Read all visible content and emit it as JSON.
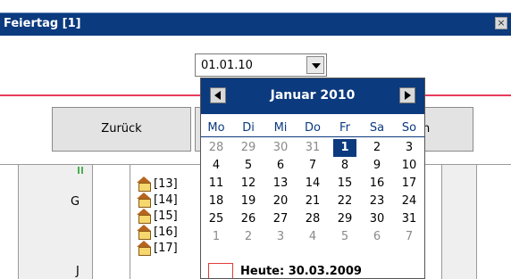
{
  "window": {
    "title": "Feiertag [1]",
    "close_glyph": "×"
  },
  "date_input": {
    "value": "01.01.10"
  },
  "buttons": {
    "back_label": "Zurück",
    "right_partial_label": "n"
  },
  "left_panel": {
    "letter": "G",
    "mark": "J"
  },
  "items": [
    "[13]",
    "[14]",
    "[15]",
    "[16]",
    "[17]"
  ],
  "calendar": {
    "title": "Januar 2010",
    "weekdays": [
      "Mo",
      "Di",
      "Mi",
      "Do",
      "Fr",
      "Sa",
      "So"
    ],
    "weeks": [
      [
        "28",
        "29",
        "30",
        "31",
        "1",
        "2",
        "3"
      ],
      [
        "4",
        "5",
        "6",
        "7",
        "8",
        "9",
        "10"
      ],
      [
        "11",
        "12",
        "13",
        "14",
        "15",
        "16",
        "17"
      ],
      [
        "18",
        "19",
        "20",
        "21",
        "22",
        "23",
        "24"
      ],
      [
        "25",
        "26",
        "27",
        "28",
        "29",
        "30",
        "31"
      ],
      [
        "1",
        "2",
        "3",
        "4",
        "5",
        "6",
        "7"
      ]
    ],
    "other_month_cells": [
      [
        0,
        0
      ],
      [
        0,
        1
      ],
      [
        0,
        2
      ],
      [
        0,
        3
      ],
      [
        5,
        0
      ],
      [
        5,
        1
      ],
      [
        5,
        2
      ],
      [
        5,
        3
      ],
      [
        5,
        4
      ],
      [
        5,
        5
      ],
      [
        5,
        6
      ]
    ],
    "selected_cell": [
      0,
      4
    ],
    "today_label": "Heute: 30.03.2009"
  },
  "colors": {
    "header": "#0b3a7e",
    "accent_line": "#e63b5a",
    "today_border": "#e23a3a"
  },
  "icons": {
    "item_icon": "house-icon",
    "prev": "arrow-left-icon",
    "next": "arrow-right-icon",
    "dropdown": "chevron-down-icon"
  }
}
